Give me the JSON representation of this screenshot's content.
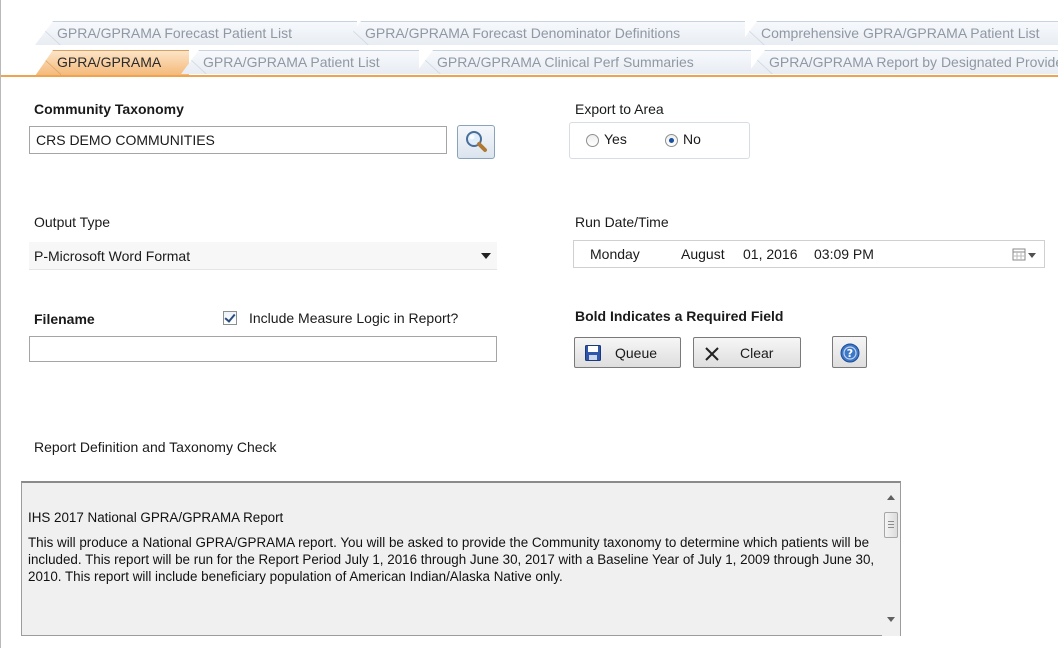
{
  "tabs": {
    "row1": [
      "GPRA/GPRAMA Forecast Patient List",
      "GPRA/GPRAMA Forecast Denominator Definitions",
      "Comprehensive GPRA/GPRAMA Patient List"
    ],
    "row2": [
      "GPRA/GPRAMA",
      "GPRA/GPRAMA Patient List",
      "GPRA/GPRAMA Clinical Perf Summaries",
      "GPRA/GPRAMA Report by Designated Provider"
    ],
    "active": "GPRA/GPRAMA"
  },
  "community_taxonomy": {
    "label": "Community Taxonomy",
    "value": "CRS DEMO COMMUNITIES"
  },
  "export_to_area": {
    "label": "Export to Area",
    "options": [
      "Yes",
      "No"
    ],
    "selected": "No"
  },
  "output_type": {
    "label": "Output Type",
    "value": "P-Microsoft Word Format"
  },
  "run_date_time": {
    "label": "Run Date/Time",
    "day": "Monday",
    "date": "August",
    "day_num": "01, 2016",
    "time": "03:09 PM"
  },
  "filename": {
    "label": "Filename",
    "value": ""
  },
  "include_measure_logic": {
    "label": "Include Measure Logic in Report?",
    "checked": true
  },
  "required_note": "Bold Indicates a Required Field",
  "buttons": {
    "queue": "Queue",
    "clear": "Clear"
  },
  "report_definition": {
    "label": "Report Definition and Taxonomy Check",
    "title": "IHS 2017 National GPRA/GPRAMA Report",
    "body": "This will produce a National GPRA/GPRAMA report.  You will be asked to provide the Community taxonomy to determine which patients will be included.  This report will be run for the Report Period July 1, 2016 through June 30, 2017 with a Baseline Year of July 1, 2009 through June 30, 2010. This report will include beneficiary population of American Indian/Alaska Native only."
  },
  "colors": {
    "active_tab": "#f4b877",
    "tab_underline": "#f0a34e",
    "inactive_tab_text": "#8f98a3"
  }
}
